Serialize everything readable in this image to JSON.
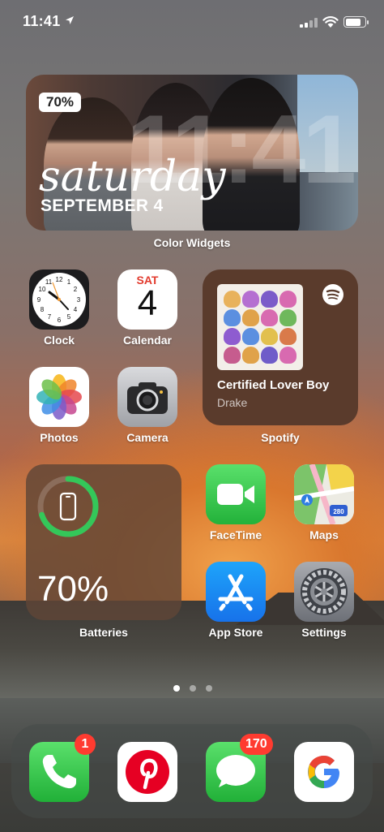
{
  "status_bar": {
    "time": "11:41"
  },
  "color_widget": {
    "battery_badge": "70%",
    "big_time": "11:41",
    "day": "saturday",
    "date": "SEPTEMBER 4",
    "label": "Color Widgets"
  },
  "apps": {
    "clock": {
      "label": "Clock",
      "icon": "clock-icon"
    },
    "calendar": {
      "label": "Calendar",
      "day": "SAT",
      "date": "4",
      "icon": "calendar-icon"
    },
    "photos": {
      "label": "Photos",
      "icon": "photos-icon"
    },
    "camera": {
      "label": "Camera",
      "icon": "camera-icon"
    },
    "facetime": {
      "label": "FaceTime",
      "icon": "facetime-icon"
    },
    "maps": {
      "label": "Maps",
      "icon": "maps-icon"
    },
    "app_store": {
      "label": "App Store",
      "icon": "app-store-icon"
    },
    "settings": {
      "label": "Settings",
      "icon": "settings-icon"
    }
  },
  "spotify_widget": {
    "title": "Certified Lover Boy",
    "artist": "Drake",
    "label": "Spotify"
  },
  "batteries_widget": {
    "percent": "70%",
    "level": 0.7,
    "label": "Batteries"
  },
  "page_indicator": {
    "pages": 3,
    "current": 1
  },
  "dock": [
    {
      "name": "phone",
      "icon": "phone-icon",
      "badge": "1"
    },
    {
      "name": "pinterest",
      "icon": "pinterest-icon",
      "badge": ""
    },
    {
      "name": "messages",
      "icon": "messages-icon",
      "badge": "170"
    },
    {
      "name": "google",
      "icon": "google-icon",
      "badge": ""
    }
  ],
  "colors": {
    "badge": "#ff3b30",
    "battery_ring": "#34c759",
    "spotify_widget_bg": "#5a3b2c"
  }
}
